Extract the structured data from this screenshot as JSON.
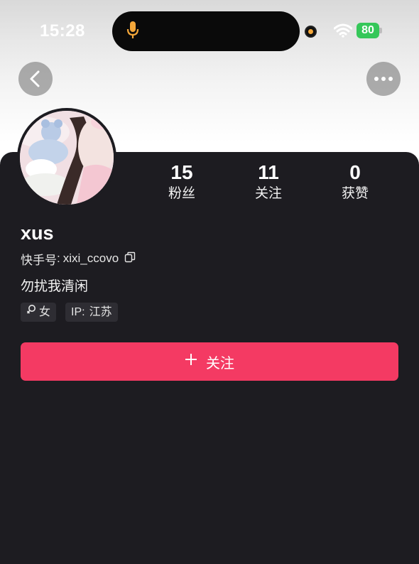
{
  "status_bar": {
    "time": "15:28",
    "battery": "80"
  },
  "nav": {
    "back_icon": "chevron-left-icon",
    "more_icon": "ellipsis-icon"
  },
  "profile": {
    "nickname": "xus",
    "kuaishou_id_label": "快手号",
    "kuaishou_id_value": "xixi_ccovo",
    "bio": "勿扰我清闲",
    "tags": {
      "gender": "女",
      "ip_label": "IP",
      "ip_value": "江苏"
    }
  },
  "stats": [
    {
      "value": "15",
      "label": "粉丝"
    },
    {
      "value": "11",
      "label": "关注"
    },
    {
      "value": "0",
      "label": "获赞"
    }
  ],
  "actions": {
    "follow_label": "关注"
  },
  "colors": {
    "panel_bg": "#1d1c21",
    "follow_button": "#f43a63",
    "battery": "#35c759",
    "mic_indicator": "#f4a73a"
  }
}
